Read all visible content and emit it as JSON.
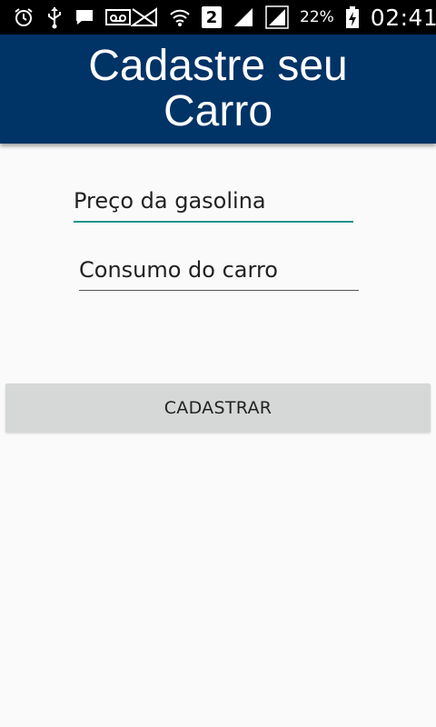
{
  "status_bar": {
    "icons_left": [
      "alarm-icon",
      "usb-icon",
      "message-icon",
      "voicemail-icon"
    ],
    "icons_right": [
      "no-signal-icon",
      "wifi-icon",
      "sim-2-icon",
      "signal-icon",
      "signal-icon",
      "battery-charging-icon"
    ],
    "sim_label": "2",
    "battery_percent": "22%",
    "time": "02:41"
  },
  "header": {
    "title": "Cadastre seu Carro",
    "background": "#003366"
  },
  "form": {
    "gas_price_placeholder": "Preço da gasolina",
    "consumption_placeholder": "Consumo do carro",
    "submit_label": "CADASTRAR",
    "focus_color": "#16968a"
  }
}
